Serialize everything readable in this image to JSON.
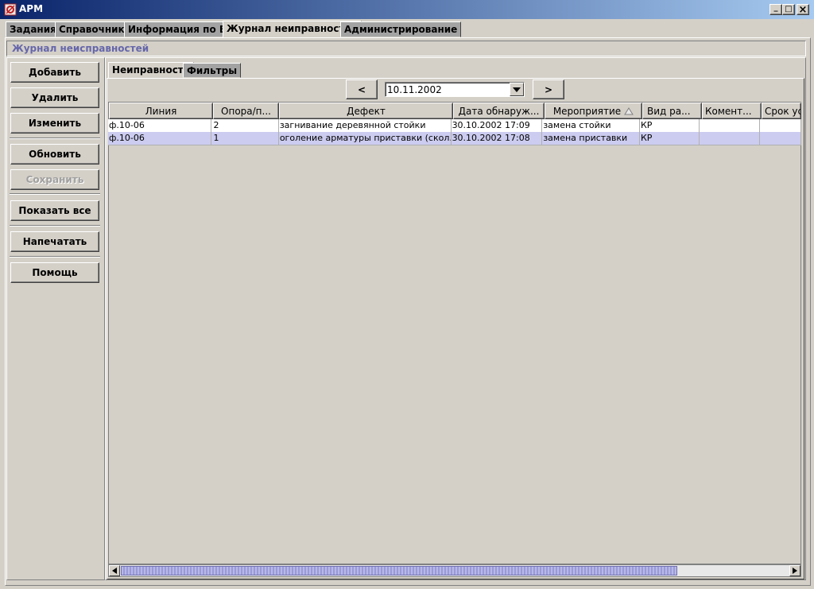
{
  "window": {
    "title": "АРМ",
    "controls": {
      "minimize": "_",
      "maximize": "□",
      "close": "×"
    }
  },
  "tabs": [
    {
      "label": "Задания"
    },
    {
      "label": "Справочники"
    },
    {
      "label": "Информация по ВЛ"
    },
    {
      "label": "Журнал неиправностей",
      "selected": true
    },
    {
      "label": "Администрирование"
    }
  ],
  "group_title": "Журнал неисправностей",
  "sidebar": {
    "add": "Добавить",
    "delete": "Удалить",
    "edit": "Изменить",
    "refresh": "Обновить",
    "save": "Сохранить",
    "show_all": "Показать все",
    "print": "Напечатать",
    "help": "Помощь"
  },
  "inner_tabs": [
    {
      "label": "Неиправности",
      "selected": true
    },
    {
      "label": "Фильтры"
    }
  ],
  "date_nav": {
    "prev": "<",
    "next": ">",
    "date": "10.11.2002"
  },
  "table": {
    "columns": [
      "Линия",
      "Опора/п...",
      "Дефект",
      "Дата обнаруж...",
      "Мероприятие",
      "Вид ра...",
      "Комент...",
      "Срок ус..."
    ],
    "sort_column": "Мероприятие",
    "rows": [
      [
        "ф.10-06",
        "2",
        "загнивание деревянной стойки",
        "30.10.2002 17:09",
        "замена стойки",
        "КР",
        "",
        ""
      ],
      [
        "ф.10-06",
        "1",
        "оголение арматуры приставки (скол...",
        "30.10.2002 17:08",
        "замена приставки",
        "КР",
        "",
        ""
      ]
    ],
    "selected_row": 1
  },
  "colors": {
    "titlebar_start": "#0a246a",
    "titlebar_end": "#a6caf0",
    "selected_row": "#ccccf0",
    "group_title": "#6666aa",
    "scroll_thumb": "#9a9ad8"
  }
}
